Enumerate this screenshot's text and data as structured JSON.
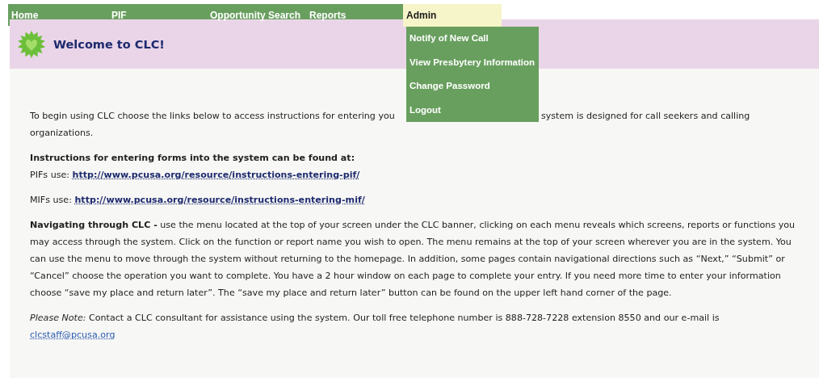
{
  "nav": [
    {
      "label": "Home",
      "selected": false
    },
    {
      "label": "PIF",
      "selected": false
    },
    {
      "label": "Opportunity Search",
      "selected": false
    },
    {
      "label": "Reports",
      "selected": false
    },
    {
      "label": "Admin",
      "selected": true
    }
  ],
  "dropdown": [
    "Notify of New Call",
    "View Presbytery Information",
    "Change Password",
    "Logout"
  ],
  "banner": {
    "title": "Welcome to CLC!"
  },
  "intro": {
    "before_menu": "To begin using CLC choose the links below to access instructions for entering you",
    "after_menu": "system is designed for call seekers and calling",
    "second_line": "organizations."
  },
  "instructions": {
    "heading": "Instructions for entering forms into the system can be found at:",
    "links": [
      {
        "label": "PIFs use:",
        "url": "http://www.pcusa.org/resource/instructions-entering-pif/"
      },
      {
        "label": "MIFs use:",
        "url": "http://www.pcusa.org/resource/instructions-entering-mif/"
      }
    ]
  },
  "navigating": "**Navigating through CLC -** use the menu located at the top of your screen under the CLC banner, clicking on each menu reveals which screens, reports or functions you may access through the system. Click on the function or report name you wish to open. The menu remains at the top of your screen wherever you are in the system. You can use the menu to move through the system without returning to the homepage. In addition, some pages contain navigational directions such as “Next,” “Submit” or “Cancel” choose the operation you want to complete. You have a 2 hour window on each page to complete your entry. If you need more time to enter your information choose “save my place and return later”. The “save my place and return later” button can be found on the upper left hand corner of the page.",
  "note": {
    "text": "*Please Note:* Contact a CLC consultant for assistance using the system. Our toll free telephone number is 888-728-7228 extension 8550 and our e-mail is",
    "email": "clcstaff@pcusa.org"
  }
}
